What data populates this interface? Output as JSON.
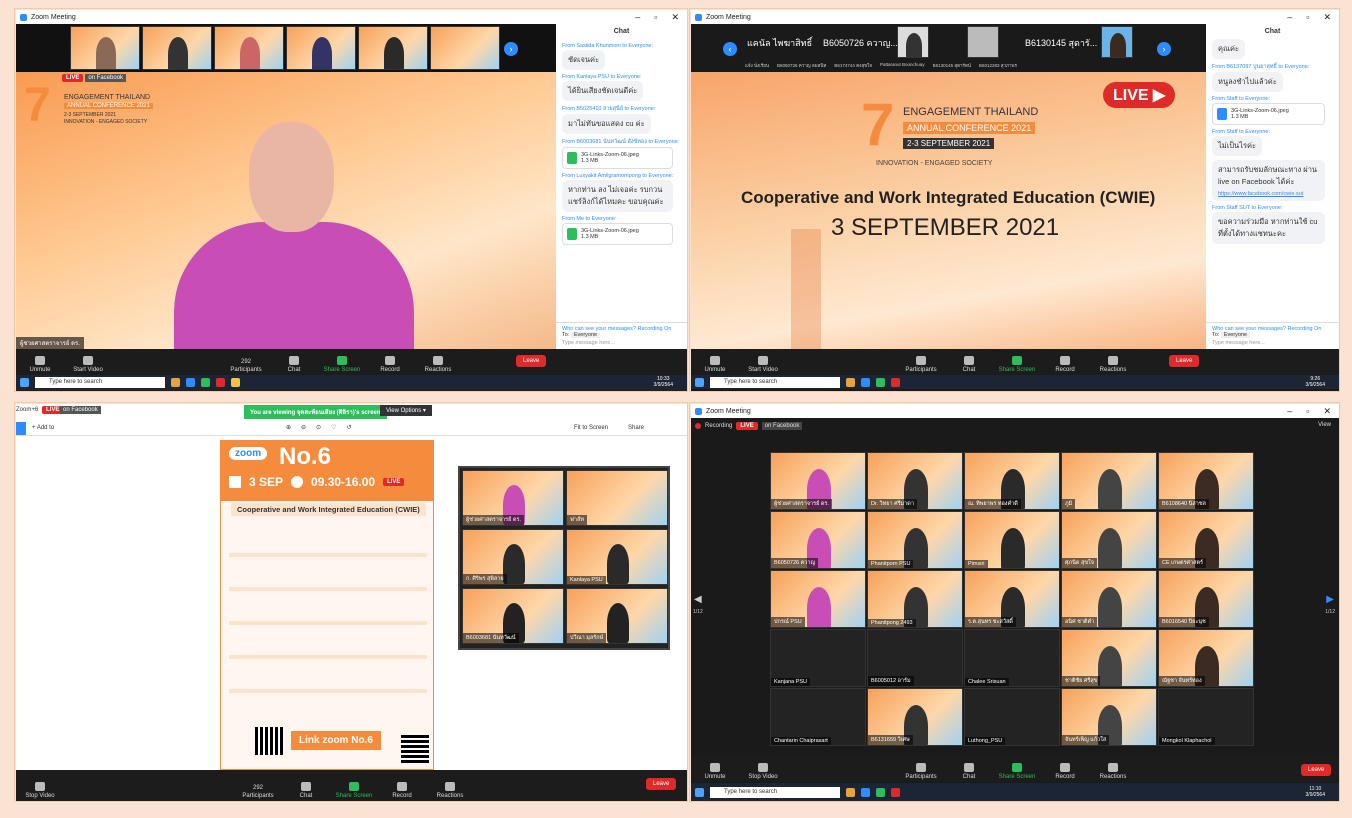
{
  "colors": {
    "page_bg": "#fbe3d4",
    "zoom_blue": "#2d8cff",
    "live_red": "#e02a2a",
    "share_green": "#2dbd5a",
    "conf_orange": "#f58b3c"
  },
  "window": {
    "title": "Zoom Meeting",
    "min": "–",
    "max": "▫",
    "close": "✕"
  },
  "toolbar": {
    "unmute": "Unmute",
    "start_video": "Start Video",
    "stop_video": "Stop Video",
    "participants": "Participants",
    "participants_count": "292",
    "chat": "Chat",
    "share": "Share Screen",
    "record": "Record",
    "reactions": "Reactions",
    "leave": "Leave"
  },
  "taskbar": {
    "search": "Type here to search",
    "time1": "10:33",
    "date": "3/9/2564",
    "time2": "9:26",
    "time4": "11:10",
    "temp": "84°F"
  },
  "q1": {
    "live": "LIVE",
    "live_on": "on Facebook",
    "event": "ENGAGEMENT THAILAND",
    "event2": "ANNUAL CONFERENCE 2021",
    "event3": "2-3 SEPTEMBER 2021",
    "event4": "INNOVATION - ENGAGED SOCIETY",
    "speaker_label": "ผู้ช่วยศาสตราจารย์ ดร.",
    "chat": {
      "title": "Chat",
      "view": "View",
      "m1_from": "From Sasiida Khunmoni to Everyone:",
      "m1": "ชัดเจนค่ะ",
      "m2_from": "From Kanlaya PSU to Everyone:",
      "m2": "ได้ยินเสียงชัดเจนดีค่ะ",
      "m3_from": "From B5025410 สายสุนีย์ to Everyone:",
      "m3": "มาไม่ทันขอแสดง cu ค่ะ",
      "m4_from": "From B6003681 นันทวัฒน์ สังข์ทอง to Everyone:",
      "file1": "3G-Links-Zoom-06.jpeg",
      "file1_size": "1.3 MB",
      "m5_from": "From Luxyakit Amilgramompong to Everyone:",
      "m5": "หากท่าน ลง ไม่เจอค่ะ รบกวนแชร์ลิงก์ได้ไหมคะ ขอบคุณค่ะ",
      "m6_from": "From Me to Everyone:",
      "file2": "3G-Links-Zoom-06.jpeg",
      "file2_size": "1.3 MB",
      "who": "Who can see your messages? Recording On",
      "to": "To:",
      "everyone": "Everyone",
      "placeholder": "Type message here..."
    }
  },
  "q2": {
    "tile1": "แคนัล ไพฆาสิทธิ์",
    "tile2": "B6050726 ควาญ...",
    "tile3": "B6130145 สุดารั...",
    "small1": "แจ้ง นั่งเรียน",
    "small2": "B6050726 ควาญ ลมสนิท",
    "small3": "B6174744 คงสุขใจ",
    "small4": "Pattaranut Boonchuay",
    "small5": "B6130145 สุดารัตน์",
    "small6": "B6012283 สุวภาพร",
    "live_big": "LIVE",
    "event": "ENGAGEMENT THAILAND",
    "event2": "ANNUAL CONFERENCE 2021",
    "event3": "2-3 SEPTEMBER 2021",
    "event4": "INNOVATION - ENGAGED SOCIETY",
    "main_title": "Cooperative and Work Integrated Education (CWIE)",
    "main_date": "3 SEPTEMBER 2021",
    "chat": {
      "title": "Chat",
      "m0": "คุณค่ะ",
      "m1_from": "From B6137097 ปูนยาสุทธิ์ to Everyone:",
      "m1": "หนูลงชำไปแล้วค่ะ",
      "m2_from": "From Staff to Everyone:",
      "file1": "3G-Links-Zoom-06.jpeg",
      "file1_size": "1.3 MB",
      "m3_from": "From Staff to Everyone:",
      "m3": "ไม่เป็นไรค่ะ",
      "m4": "สามารถรับชมลักษณะทาง ผ่าน live on Facebook ได้ค่ะ",
      "link": "https://www.facebook.com/cwie.sut",
      "m5_from": "From Staff SUT to Everyone:",
      "m5": "ขอความร่วมมือ หากท่านใช้ cu ที่ตั้งได้ทางแชทนะคะ",
      "who": "Who can see your messages? Recording On",
      "to": "To:",
      "everyone": "Everyone",
      "placeholder": "Type message here..."
    }
  },
  "q3": {
    "banner": "You are viewing จุดสะท้อนเสียง (ศิลิรา)'s screen",
    "view_options": "View Options ▾",
    "live": "LIVE",
    "live_on": "on Facebook",
    "tab": "Zoom+6",
    "add": "+ Add to",
    "fit": "Fit to Screen",
    "share": "Share",
    "poster_zoom": "zoom",
    "poster_no": "No.6",
    "poster_date": "3 SEP",
    "poster_time": "09.30-16.00",
    "poster_title": "Cooperative and Work Integrated Education (CWIE)",
    "poster_live": "LIVE",
    "link_zoom": "Link zoom No.6",
    "gallery": [
      "ผู้ช่วยศาสตราจารย์ ดร.",
      "ฟาส์ท",
      "ก. ศิริพร สุพิลาย",
      "Kanlaya PSU",
      "B6003681 นันทวัฒน์",
      "ปวีณา มุลรักษ์"
    ]
  },
  "q4": {
    "recording": "Recording",
    "live": "LIVE",
    "live_on": "on Facebook",
    "view": "View",
    "page_left": "1/12",
    "page_right": "1/12",
    "tiles": [
      "ผู้ช่วยศาสตราจารย์ ดร.",
      "Dr. วิทยา ศรีมาดา",
      "ณ. ทิพยาพร ทองคำดี",
      "ภูมิ",
      "B6108640 นิสาชล",
      "B6050726 ควาญ",
      "Phanitporn PSU",
      "Pimsiri",
      "ศุภนิด สุขใจ",
      "CE เกษตรศาสตร์",
      "ปกรณ์ PSU",
      "Phanitpong 2493",
      "ร.ต.สุนทร ชะสวัสดิ์",
      "อนิศ ชาติคำ",
      "B6016540 ปิยะนุช",
      "Kanjana PSU",
      "B6005012 อาร์ม",
      "Chalee Srisuan",
      "ชาติชัย ศรีสุข",
      "ณัฐชา จันทร์ทอง",
      "Chantarin Chaiprasart",
      "B6131659 วิเศษ",
      "Luthong_PSU",
      "จันทร์เพ็ญ แก้วใส",
      "Mongkol Klaphachol"
    ]
  }
}
